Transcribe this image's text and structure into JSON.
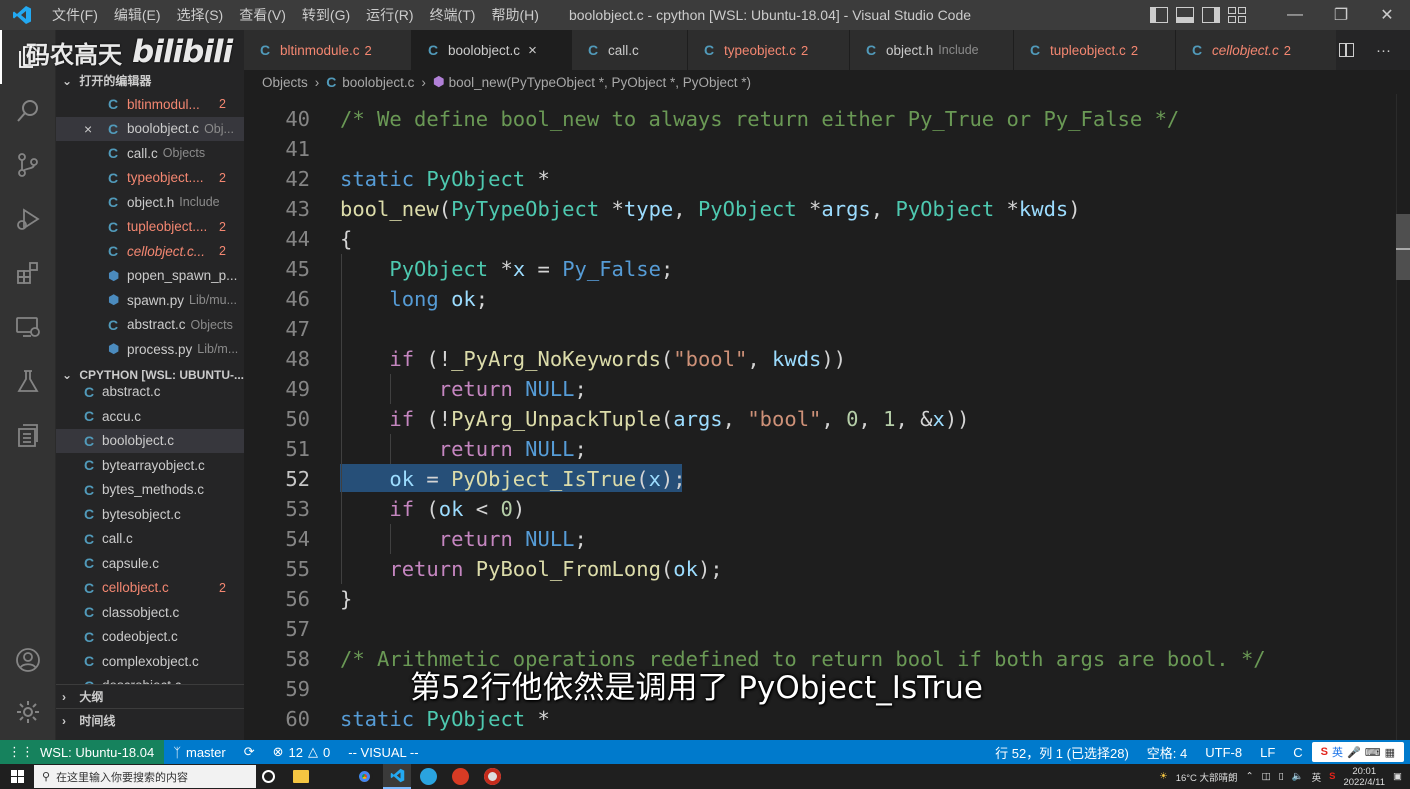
{
  "titlebar": {
    "menus": [
      "文件(F)",
      "编辑(E)",
      "选择(S)",
      "查看(V)",
      "转到(G)",
      "运行(R)",
      "终端(T)",
      "帮助(H)"
    ],
    "title": "boolobject.c - cpython [WSL: Ubuntu-18.04] - Visual Studio Code"
  },
  "watermark": {
    "text": "码农高天",
    "logo": "bilibili"
  },
  "sidebar": {
    "open_editors_title": "打开的编辑器",
    "open_editors": [
      {
        "icon": "c-file-icon",
        "name": "bltinmodul...",
        "badge": "2",
        "error": true
      },
      {
        "icon": "c-file-icon",
        "name": "boolobject.c",
        "desc": "Obj...",
        "close": "×",
        "selected": true
      },
      {
        "icon": "c-file-icon",
        "name": "call.c",
        "desc": "Objects"
      },
      {
        "icon": "c-file-icon",
        "name": "typeobject....",
        "badge": "2",
        "error": true
      },
      {
        "icon": "c-file-icon",
        "name": "object.h",
        "desc": "Include"
      },
      {
        "icon": "c-file-icon",
        "name": "tupleobject....",
        "badge": "2",
        "error": true
      },
      {
        "icon": "c-file-icon",
        "name": "cellobject.c...",
        "badge": "2",
        "error": true,
        "italic": true
      },
      {
        "icon": "python-file-icon",
        "name": "popen_spawn_p..."
      },
      {
        "icon": "python-file-icon",
        "name": "spawn.py",
        "desc": "Lib/mu..."
      },
      {
        "icon": "c-file-icon",
        "name": "abstract.c",
        "desc": "Objects"
      },
      {
        "icon": "python-file-icon",
        "name": "process.py",
        "desc": "Lib/m..."
      }
    ],
    "explorer_title": "CPYTHON [WSL: UBUNTU-...",
    "files": [
      {
        "name": "abstract.c"
      },
      {
        "name": "accu.c"
      },
      {
        "name": "boolobject.c",
        "selected": true
      },
      {
        "name": "bytearrayobject.c"
      },
      {
        "name": "bytes_methods.c"
      },
      {
        "name": "bytesobject.c"
      },
      {
        "name": "call.c"
      },
      {
        "name": "capsule.c"
      },
      {
        "name": "cellobject.c",
        "error": true,
        "badge": "2"
      },
      {
        "name": "classobject.c"
      },
      {
        "name": "codeobject.c"
      },
      {
        "name": "complexobject.c"
      },
      {
        "name": "descrobject.c"
      }
    ],
    "outline_title": "大纲",
    "timeline_title": "时间线"
  },
  "tabs": [
    {
      "name": "bltinmodule.c",
      "badge": "2",
      "error": true
    },
    {
      "name": "boolobject.c",
      "active": true,
      "close": "×"
    },
    {
      "name": "call.c"
    },
    {
      "name": "typeobject.c",
      "badge": "2",
      "error": true
    },
    {
      "name": "object.h",
      "desc": "Include"
    },
    {
      "name": "tupleobject.c",
      "badge": "2",
      "error": true
    },
    {
      "name": "cellobject.c",
      "badge": "2",
      "error": true,
      "italic": true
    }
  ],
  "breadcrumb": [
    "Objects",
    "boolobject.c",
    "bool_new(PyTypeObject *, PyObject *, PyObject *)"
  ],
  "editor": {
    "current_line": 52,
    "lines": [
      {
        "n": 40,
        "tokens": [
          [
            "cm",
            "/* We define bool_new to always return either Py_True or Py_False */"
          ]
        ]
      },
      {
        "n": 41,
        "tokens": []
      },
      {
        "n": 42,
        "tokens": [
          [
            "kw",
            "static"
          ],
          [
            "pl",
            " "
          ],
          [
            "ty",
            "PyObject"
          ],
          [
            "pl",
            " *"
          ]
        ]
      },
      {
        "n": 43,
        "tokens": [
          [
            "fn",
            "bool_new"
          ],
          [
            "pl",
            "("
          ],
          [
            "ty",
            "PyTypeObject"
          ],
          [
            "pl",
            " *"
          ],
          [
            "vr",
            "type"
          ],
          [
            "pl",
            ", "
          ],
          [
            "ty",
            "PyObject"
          ],
          [
            "pl",
            " *"
          ],
          [
            "vr",
            "args"
          ],
          [
            "pl",
            ", "
          ],
          [
            "ty",
            "PyObject"
          ],
          [
            "pl",
            " *"
          ],
          [
            "vr",
            "kwds"
          ],
          [
            "pl",
            ")"
          ]
        ]
      },
      {
        "n": 44,
        "tokens": [
          [
            "pl",
            "{"
          ]
        ]
      },
      {
        "n": 45,
        "tokens": [
          [
            "pl",
            "    "
          ],
          [
            "ty",
            "PyObject"
          ],
          [
            "pl",
            " *"
          ],
          [
            "vr",
            "x"
          ],
          [
            "pl",
            " = "
          ],
          [
            "kw",
            "Py_False"
          ],
          [
            "pl",
            ";"
          ]
        ]
      },
      {
        "n": 46,
        "tokens": [
          [
            "pl",
            "    "
          ],
          [
            "kw",
            "long"
          ],
          [
            "pl",
            " "
          ],
          [
            "vr",
            "ok"
          ],
          [
            "pl",
            ";"
          ]
        ]
      },
      {
        "n": 47,
        "tokens": []
      },
      {
        "n": 48,
        "tokens": [
          [
            "pl",
            "    "
          ],
          [
            "ctl",
            "if"
          ],
          [
            "pl",
            " (!"
          ],
          [
            "fn",
            "_PyArg_NoKeywords"
          ],
          [
            "pl",
            "("
          ],
          [
            "st",
            "\"bool\""
          ],
          [
            "pl",
            ", "
          ],
          [
            "vr",
            "kwds"
          ],
          [
            "pl",
            "))"
          ]
        ]
      },
      {
        "n": 49,
        "tokens": [
          [
            "pl",
            "        "
          ],
          [
            "ctl",
            "return"
          ],
          [
            "pl",
            " "
          ],
          [
            "kw",
            "NULL"
          ],
          [
            "pl",
            ";"
          ]
        ]
      },
      {
        "n": 50,
        "tokens": [
          [
            "pl",
            "    "
          ],
          [
            "ctl",
            "if"
          ],
          [
            "pl",
            " (!"
          ],
          [
            "fn",
            "PyArg_UnpackTuple"
          ],
          [
            "pl",
            "("
          ],
          [
            "vr",
            "args"
          ],
          [
            "pl",
            ", "
          ],
          [
            "st",
            "\"bool\""
          ],
          [
            "pl",
            ", "
          ],
          [
            "nm",
            "0"
          ],
          [
            "pl",
            ", "
          ],
          [
            "nm",
            "1"
          ],
          [
            "pl",
            ", &"
          ],
          [
            "vr",
            "x"
          ],
          [
            "pl",
            "))"
          ]
        ]
      },
      {
        "n": 51,
        "tokens": [
          [
            "pl",
            "        "
          ],
          [
            "ctl",
            "return"
          ],
          [
            "pl",
            " "
          ],
          [
            "kw",
            "NULL"
          ],
          [
            "pl",
            ";"
          ]
        ]
      },
      {
        "n": 52,
        "tokens": [
          [
            "pl",
            "    "
          ],
          [
            "vr",
            "ok"
          ],
          [
            "pl",
            " = "
          ],
          [
            "fn",
            "PyObject_IsTrue"
          ],
          [
            "pl",
            "("
          ],
          [
            "vr",
            "x"
          ],
          [
            "pl",
            ");"
          ]
        ]
      },
      {
        "n": 53,
        "tokens": [
          [
            "pl",
            "    "
          ],
          [
            "ctl",
            "if"
          ],
          [
            "pl",
            " ("
          ],
          [
            "vr",
            "ok"
          ],
          [
            "pl",
            " < "
          ],
          [
            "nm",
            "0"
          ],
          [
            "pl",
            ")"
          ]
        ]
      },
      {
        "n": 54,
        "tokens": [
          [
            "pl",
            "        "
          ],
          [
            "ctl",
            "return"
          ],
          [
            "pl",
            " "
          ],
          [
            "kw",
            "NULL"
          ],
          [
            "pl",
            ";"
          ]
        ]
      },
      {
        "n": 55,
        "tokens": [
          [
            "pl",
            "    "
          ],
          [
            "ctl",
            "return"
          ],
          [
            "pl",
            " "
          ],
          [
            "fn",
            "PyBool_FromLong"
          ],
          [
            "pl",
            "("
          ],
          [
            "vr",
            "ok"
          ],
          [
            "pl",
            ");"
          ]
        ]
      },
      {
        "n": 56,
        "tokens": [
          [
            "pl",
            "}"
          ]
        ]
      },
      {
        "n": 57,
        "tokens": []
      },
      {
        "n": 58,
        "tokens": [
          [
            "cm",
            "/* Arithmetic operations redefined to return bool if both args are bool. */"
          ]
        ]
      },
      {
        "n": 59,
        "tokens": []
      },
      {
        "n": 60,
        "tokens": [
          [
            "kw",
            "static"
          ],
          [
            "pl",
            " "
          ],
          [
            "ty",
            "PyObject"
          ],
          [
            "pl",
            " *"
          ]
        ]
      }
    ]
  },
  "subtitle": "第52行他依然是调用了 PyObject_IsTrue",
  "statusbar": {
    "remote": "WSL: Ubuntu-18.04",
    "branch": "master",
    "errors": "12",
    "warnings": "0",
    "mode": "-- VISUAL --",
    "cursor": "行 52，列 1 (已选择28)",
    "spaces": "空格: 4",
    "encoding": "UTF-8",
    "eol": "LF",
    "language": "C",
    "ime": "英"
  },
  "taskbar": {
    "search_placeholder": "在这里输入你要搜索的内容",
    "weather": "16°C  大部晴朗",
    "lang": "英",
    "time": "20:01",
    "date": "2022/4/11"
  },
  "colors": {
    "accent": "#007acc",
    "remote": "#16825d",
    "selection": "#264f78",
    "error": "#f48771"
  }
}
